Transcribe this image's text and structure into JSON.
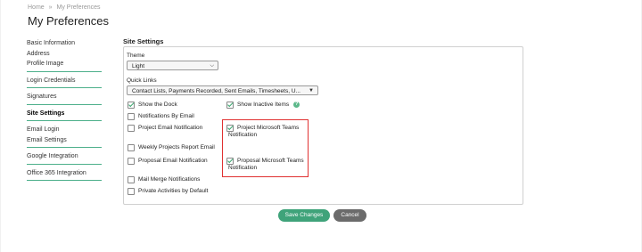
{
  "breadcrumb": {
    "home": "Home",
    "sep": "»",
    "current": "My Preferences"
  },
  "title": "My Preferences",
  "sidebar": {
    "groups": [
      [
        "Basic Information",
        "Address",
        "Profile Image"
      ],
      [
        "Login Credentials"
      ],
      [
        "Signatures"
      ],
      [
        "Site Settings"
      ],
      [
        "Email Login",
        "Email Settings"
      ],
      [
        "Google Integration"
      ],
      [
        "Office 365 Integration"
      ]
    ],
    "active": "Site Settings"
  },
  "section_title": "Site Settings",
  "theme": {
    "label": "Theme",
    "value": "Light"
  },
  "quick_links": {
    "label": "Quick Links",
    "value": "Contact Lists, Payments Recorded, Sent Emails, Timesheets, U..."
  },
  "checkboxes": {
    "show_dock": {
      "label": "Show the Dock",
      "checked": true
    },
    "show_inactive": {
      "label": "Show Inactive Items",
      "checked": true
    },
    "notifications_by_email": {
      "label": "Notifications By Email",
      "checked": false
    },
    "project_email_notification": {
      "label": "Project Email Notification",
      "checked": false
    },
    "project_teams_notification": {
      "label": "Project Microsoft Teams Notification",
      "checked": true
    },
    "weekly_projects_report_email": {
      "label": "Weekly Projects Report Email",
      "checked": false
    },
    "proposal_email_notification": {
      "label": "Proposal Email Notification",
      "checked": false
    },
    "proposal_teams_notification": {
      "label": "Proposal Microsoft Teams Notification",
      "checked": true
    },
    "mail_merge_notifications": {
      "label": "Mail Merge Notifications",
      "checked": false
    },
    "private_activities_by_default": {
      "label": "Private Activities by Default",
      "checked": false
    }
  },
  "help_icon": "?",
  "buttons": {
    "save": "Save Changes",
    "cancel": "Cancel"
  },
  "colors": {
    "accent": "#3fa37a",
    "highlight": "#e03131",
    "cancel": "#6b6b6b"
  }
}
